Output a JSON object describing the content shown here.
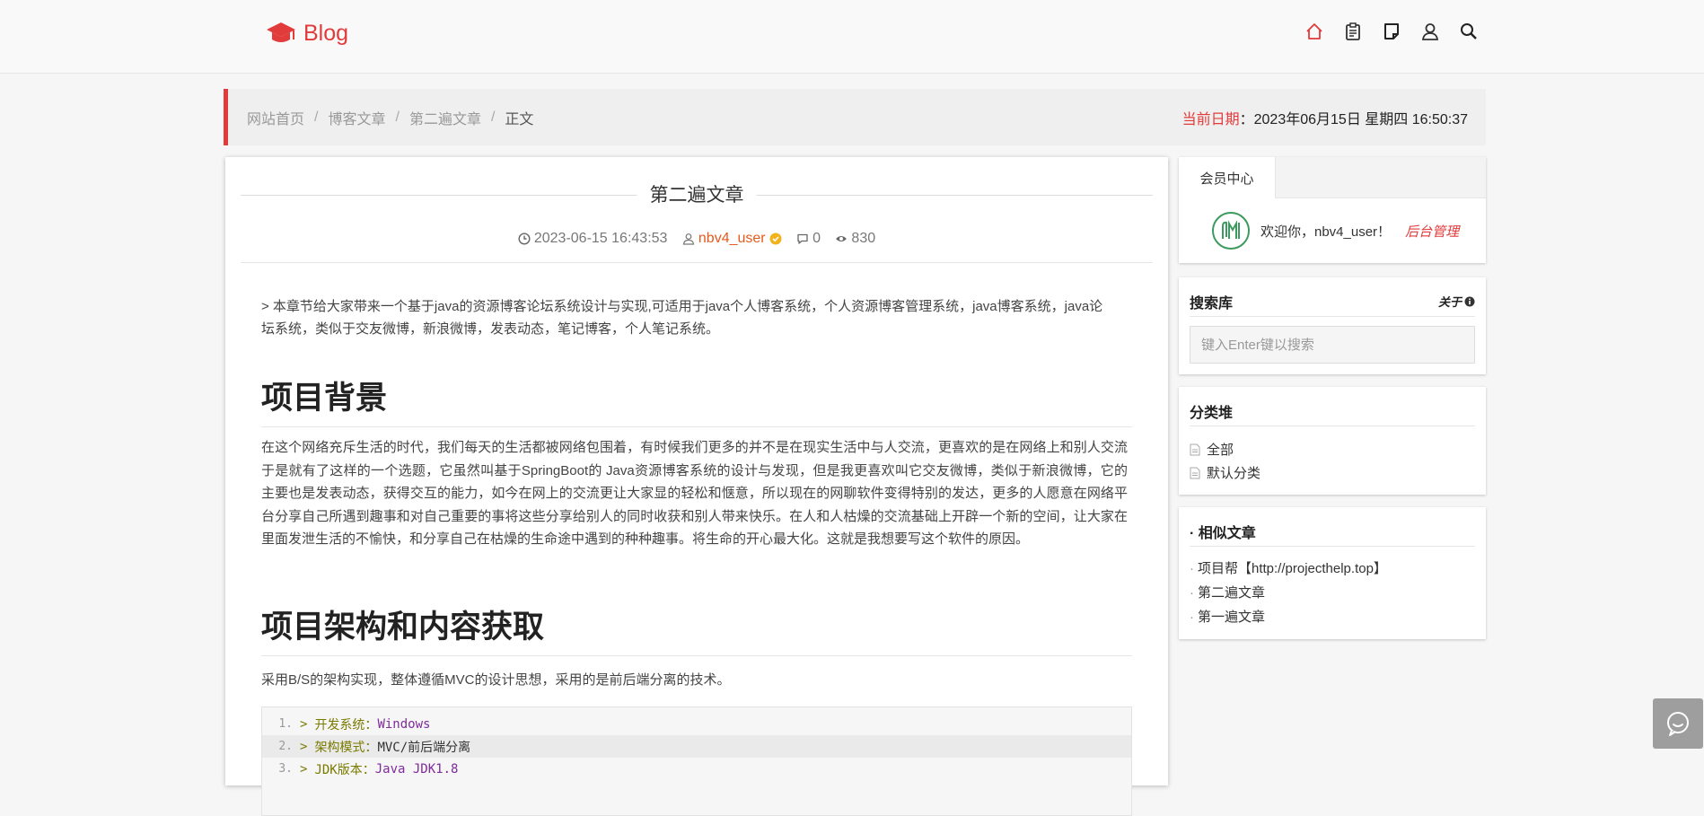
{
  "brand": {
    "name": "Blog",
    "color": "#e23b3b"
  },
  "nav_icons": [
    "home-icon",
    "clipboard-icon",
    "note-icon",
    "user-icon",
    "search-icon"
  ],
  "breadcrumb": {
    "items": [
      "网站首页",
      "博客文章",
      "第二遍文章"
    ],
    "current": "正文",
    "separator": "/"
  },
  "date": {
    "label": "当前日期",
    "colon": "：",
    "value": "2023年06月15日 星期四 16:50:37"
  },
  "article": {
    "title": "第二遍文章",
    "datetime": "2023-06-15 16:43:53",
    "author": "nbv4_user",
    "comments": "0",
    "views": "830",
    "intro": "> 本章节给大家带来一个基于java的资源博客论坛系统设计与实现,可适用于java个人博客系统，个人资源博客管理系统，java博客系统，java论坛系统，类似于交友微博，新浪微博，发表动态，笔记博客，个人笔记系统。",
    "h2_1": "项目背景",
    "para_1": "在这个网络充斥生活的时代，我们每天的生活都被网络包围着，有时候我们更多的并不是在现实生活中与人交流，更喜欢的是在网络上和别人交流于是就有了这样的一个选题，它虽然叫基于SpringBoot的 Java资源博客系统的设计与发现，但是我更喜欢叫它交友微博，类似于新浪微博，它的主要也是发表动态，获得交互的能力，如今在网上的交流更让大家显的轻松和惬意，所以现在的网聊软件变得特别的发达，更多的人愿意在网络平台分享自己所遇到趣事和对自己重要的事将这些分享给别人的同时收获和别人带来快乐。在人和人枯燥的交流基础上开辟一个新的空间，让大家在里面发泄生活的不愉快，和分享自己在枯燥的生命途中遇到的种种趣事。将生命的开心最大化。这就是我想要写这个软件的原因。",
    "h2_2": "项目架构和内容获取",
    "para_2": "采用B/S的架构实现，整体遵循MVC的设计思想，采用的是前后端分离的技术。",
    "code_lines": [
      {
        "num": "1.",
        "key": "开发系统：",
        "val": "Windows"
      },
      {
        "num": "2.",
        "key": "架构模式：",
        "val": "MVC/前后端分离"
      },
      {
        "num": "3.",
        "key": "JDK版本：",
        "val": "Java JDK1.8"
      }
    ]
  },
  "sidebar": {
    "member": {
      "tab": "会员中心",
      "welcome": "欢迎你，nbv4_user！",
      "admin_link": "后台管理"
    },
    "search": {
      "title": "搜索库",
      "about": "关于",
      "placeholder": "键入Enter键以搜索"
    },
    "categories": {
      "title": "分类堆",
      "items": [
        "全部",
        "默认分类"
      ]
    },
    "similar": {
      "title": "· 相似文章",
      "items": [
        "项目帮【http://projecthelp.top】",
        "第二遍文章",
        "第一遍文章"
      ]
    }
  }
}
